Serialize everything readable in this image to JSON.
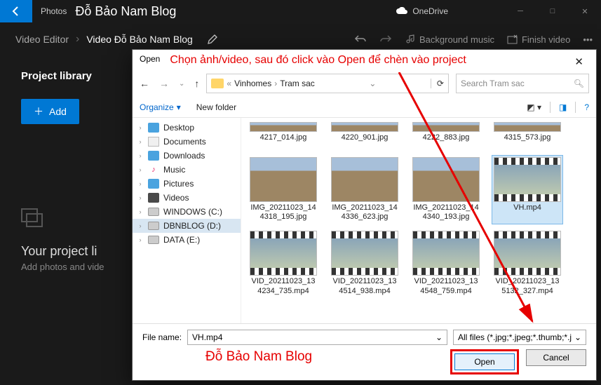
{
  "titlebar": {
    "app_name": "Photos",
    "blog_title": "Đỗ Bảo Nam Blog",
    "cloud_label": "OneDrive"
  },
  "toolbar": {
    "video_editor": "Video Editor",
    "project_name": "Video Đỗ Bảo Nam Blog",
    "bg_music": "Background music",
    "finish": "Finish video"
  },
  "library": {
    "title": "Project library",
    "add_label": "Add",
    "empty_title": "Your project li",
    "empty_sub": "Add photos and vide"
  },
  "dialog": {
    "title": "Open",
    "annotation": "Chọn ảnh/video, sau đó click vào Open để chèn vào project",
    "breadcrumb_prefix": "«",
    "breadcrumb": [
      "Vinhomes",
      "Tram sac"
    ],
    "search_placeholder": "Search Tram sac",
    "organize": "Organize",
    "new_folder": "New folder",
    "tree": [
      {
        "label": "Desktop",
        "icon": "desktop"
      },
      {
        "label": "Documents",
        "icon": "doc"
      },
      {
        "label": "Downloads",
        "icon": "download"
      },
      {
        "label": "Music",
        "icon": "music"
      },
      {
        "label": "Pictures",
        "icon": "pic"
      },
      {
        "label": "Videos",
        "icon": "video"
      },
      {
        "label": "WINDOWS (C:)",
        "icon": "drive"
      },
      {
        "label": "DBNBLOG (D:)",
        "icon": "drive",
        "selected": true
      },
      {
        "label": "DATA (E:)",
        "icon": "drive"
      }
    ],
    "top_files": [
      "4217_014.jpg",
      "4220_901.jpg",
      "4222_883.jpg",
      "4315_573.jpg"
    ],
    "files_row1": [
      {
        "name": "IMG_20211023_144318_195.jpg",
        "type": "photo"
      },
      {
        "name": "IMG_20211023_144336_623.jpg",
        "type": "photo"
      },
      {
        "name": "IMG_20211023_144340_193.jpg",
        "type": "photo"
      },
      {
        "name": "VH.mp4",
        "type": "video",
        "selected": true
      }
    ],
    "files_row2": [
      {
        "name": "VID_20211023_134234_735.mp4",
        "type": "video"
      },
      {
        "name": "VID_20211023_134514_938.mp4",
        "type": "video"
      },
      {
        "name": "VID_20211023_134548_759.mp4",
        "type": "video"
      },
      {
        "name": "VID_20211023_135132_327.mp4",
        "type": "video"
      }
    ],
    "filename_label": "File name:",
    "filename_value": "VH.mp4",
    "filter_label": "All files (*.jpg;*.jpeg;*.thumb;*.j",
    "open_btn": "Open",
    "cancel_btn": "Cancel",
    "watermark": "Đỗ Bảo Nam Blog"
  }
}
